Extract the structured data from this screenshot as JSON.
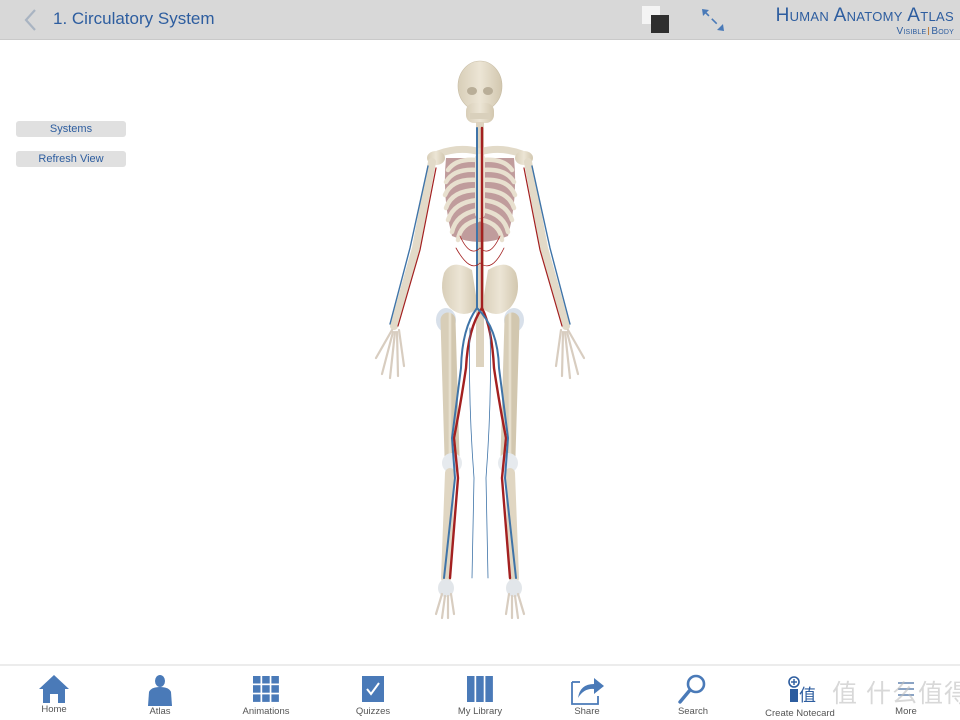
{
  "header": {
    "title": "1. Circulatory System",
    "back_icon": "chevron-left-icon",
    "view_toggle_icon": "background-toggle-icon",
    "expand_icon": "expand-arrows-icon",
    "brand_title": "Human Anatomy Atlas",
    "brand_sub_left": "Visible",
    "brand_sub_right": "Body"
  },
  "side_buttons": {
    "systems": "Systems",
    "refresh_view": "Refresh View"
  },
  "model": {
    "description": "3D full-body anterior view: skeleton with arteries (red) and veins (blue)"
  },
  "tabbar": {
    "items": [
      {
        "label": "Home",
        "icon": "home-icon"
      },
      {
        "label": "Atlas",
        "icon": "person-icon"
      },
      {
        "label": "Animations",
        "icon": "grid-icon"
      },
      {
        "label": "Quizzes",
        "icon": "checkbox-icon"
      },
      {
        "label": "My Library",
        "icon": "library-icon"
      },
      {
        "label": "Share",
        "icon": "share-icon"
      },
      {
        "label": "Search",
        "icon": "search-icon"
      },
      {
        "label": "Create Notecard",
        "icon": "notecard-icon"
      },
      {
        "label": "More",
        "icon": "more-icon"
      }
    ]
  },
  "watermark": "值 什么值得买",
  "colors": {
    "accent": "#4a7ab8",
    "title": "#2d5d9f",
    "header_bg": "#d8d8d8",
    "artery": "#a32020",
    "vein": "#3f74a8",
    "bone": "#e4dccb"
  }
}
